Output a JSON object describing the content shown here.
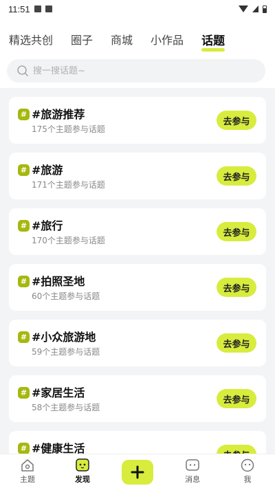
{
  "status": {
    "time": "11:51"
  },
  "tabs": [
    {
      "label": "精选共创"
    },
    {
      "label": "圈子"
    },
    {
      "label": "商城"
    },
    {
      "label": "小作品"
    },
    {
      "label": "话题",
      "active": true
    }
  ],
  "search": {
    "placeholder": "搜一搜话题~"
  },
  "topics": [
    {
      "title": "#旅游推荐",
      "sub": "175个主题参与话题",
      "button": "去参与"
    },
    {
      "title": "#旅游",
      "sub": "171个主题参与话题",
      "button": "去参与"
    },
    {
      "title": "#旅行",
      "sub": "170个主题参与话题",
      "button": "去参与"
    },
    {
      "title": "#拍照圣地",
      "sub": "60个主题参与话题",
      "button": "去参与"
    },
    {
      "title": "#小众旅游地",
      "sub": "59个主题参与话题",
      "button": "去参与"
    },
    {
      "title": "#家居生活",
      "sub": "58个主题参与话题",
      "button": "去参与"
    },
    {
      "title": "#健康生活",
      "sub": "",
      "button": "去参与"
    }
  ],
  "hash_glyph": "#",
  "nav": {
    "home": "主题",
    "discover": "发现",
    "messages": "消息",
    "me": "我"
  },
  "colors": {
    "accent": "#d7ec3d",
    "hash_badge": "#a6b80f"
  }
}
